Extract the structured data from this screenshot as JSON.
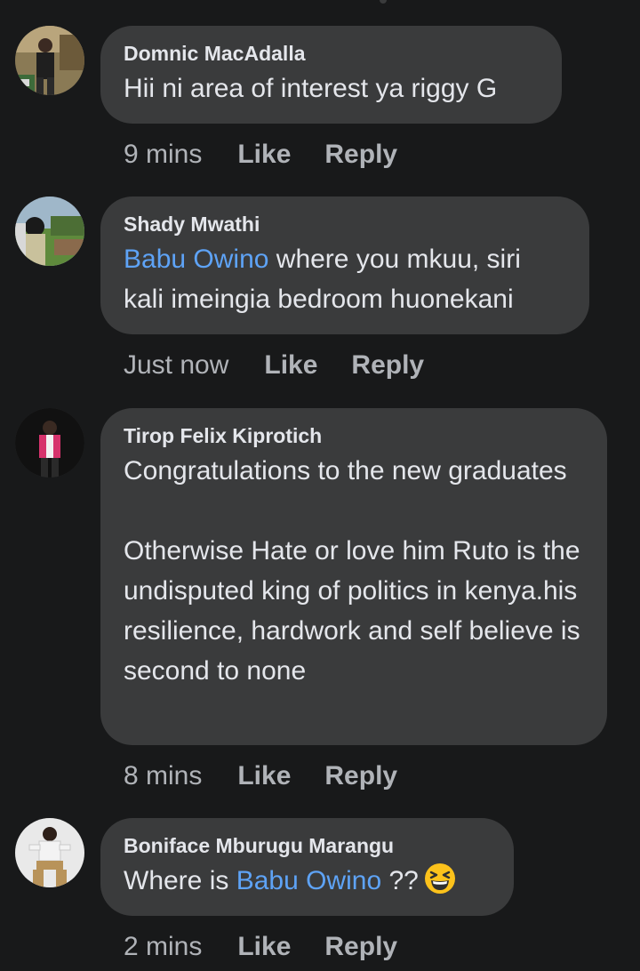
{
  "comments": [
    {
      "author": "Domnic MacAdalla",
      "text": "Hii ni area of interest ya riggy G",
      "time": "9 mins",
      "like_label": "Like",
      "reply_label": "Reply"
    },
    {
      "author": "Shady Mwathi",
      "mention": "Babu Owino",
      "text_after_mention": " where you mkuu, siri kali imeingia bedroom huonekani",
      "time": "Just now",
      "like_label": "Like",
      "reply_label": "Reply"
    },
    {
      "author": "Tirop Felix Kiprotich",
      "text": "Congratulations to the new graduates\n\nOtherwise Hate or love him Ruto is the undisputed king of politics in kenya.his resilience, hardwork and self believe is second to none",
      "time": "8 mins",
      "like_label": "Like",
      "reply_label": "Reply"
    },
    {
      "author": "Boniface Mburugu Marangu",
      "text_before_mention": "Where is ",
      "mention": "Babu Owino",
      "text_after_mention": " ??",
      "emoji": "grinning-squinting-face-emoji",
      "time": "2 mins",
      "like_label": "Like",
      "reply_label": "Reply"
    }
  ],
  "colors": {
    "background": "#18191a",
    "bubble": "#3a3b3c",
    "text": "#e4e6eb",
    "secondary_text": "#b0b3b8",
    "mention": "#5ea3f6"
  }
}
